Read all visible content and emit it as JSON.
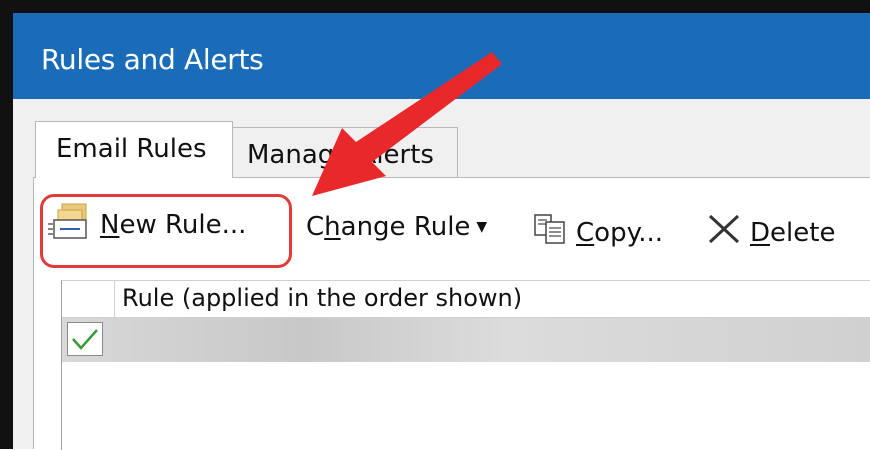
{
  "window": {
    "title": "Rules and Alerts"
  },
  "tabs": [
    {
      "label": "Email Rules",
      "active": true
    },
    {
      "label": "Manage Alerts",
      "active": false
    }
  ],
  "toolbar": {
    "new_rule": {
      "mnemonic": "N",
      "rest": "ew Rule...",
      "icon": "new-rule-icon"
    },
    "change_rule": {
      "pre": "C",
      "mnemonic": "h",
      "rest": "ange Rule",
      "icon": "dropdown-caret-icon"
    },
    "copy": {
      "mnemonic": "C",
      "rest": "opy...",
      "icon": "copy-icon"
    },
    "delete": {
      "mnemonic": "D",
      "rest": "elete",
      "icon": "delete-x-icon"
    }
  },
  "rules_list": {
    "header": "Rule (applied in the order shown)",
    "rows": [
      {
        "checked": true
      }
    ]
  },
  "colors": {
    "titlebar": "#1b6cb8",
    "highlight_box": "#e23b3b",
    "annotation_arrow": "#e8282b",
    "checkmark": "#3a9a3a"
  }
}
